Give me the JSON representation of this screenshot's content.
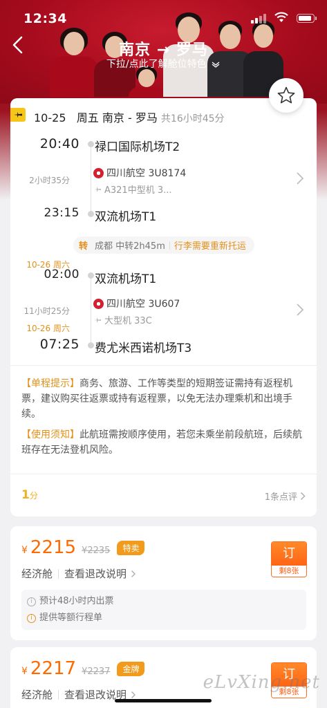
{
  "status": {
    "time": "12:34"
  },
  "header": {
    "title": "南京 → 罗马",
    "subtitle": "下拉/点此了解舱位特色"
  },
  "trip": {
    "date": "10-25",
    "weekday": "周五",
    "route": "南京 - 罗马",
    "total_duration": "共16小时45分",
    "seg1": {
      "dep_time": "20:40",
      "dep_airport": "禄口国际机场T2",
      "duration": "2小时35分",
      "airline": "四川航空 3U8174",
      "aircraft": "A321中型机 3...",
      "arr_time": "23:15",
      "arr_airport": "双流机场T1"
    },
    "transfer": {
      "label": "转",
      "city": "成都 中转2h45m",
      "note": "行李需要重新托运"
    },
    "seg2": {
      "dep_date": "10-26 周六",
      "dep_time": "02:00",
      "dep_airport": "双流机场T1",
      "duration": "11小时25分",
      "airline": "四川航空 3U607",
      "aircraft": "大型机 33C",
      "arr_date": "10-26 周六",
      "arr_time": "07:25",
      "arr_airport": "费尤米西诺机场T3"
    },
    "notice1_tag": "【单程提示】",
    "notice1_text": "商务、旅游、工作等类型的短期签证需持有返程机票，建议购买往返票或持有返程票，以免无法办理乘机和出境手续。",
    "notice2_tag": "【使用须知】",
    "notice2_text": "此航班需按顺序使用，若您未乘坐前段航班，后续航班存在无法登机风险。",
    "score": "1",
    "score_unit": "分",
    "reviews": "1条点评"
  },
  "fares": [
    {
      "currency": "¥",
      "price": "2215",
      "original": "¥2235",
      "badge": "特卖",
      "cabin": "经济舱",
      "rule_link": "查看退改说明",
      "book_label": "订",
      "remaining": "剩8张",
      "info1": "预计48小时内出票",
      "info2": "提供等额行程单"
    },
    {
      "currency": "¥",
      "price": "2217",
      "original": "¥2237",
      "badge": "金牌",
      "cabin": "经济舱",
      "rule_link": "查看退改说明",
      "book_label": "订",
      "remaining": "剩8张"
    }
  ],
  "watermark": "eLvXing.net",
  "colors": {
    "accent": "#ff6a00",
    "brand_red": "#b30f22",
    "tag_orange": "#e3901a"
  }
}
